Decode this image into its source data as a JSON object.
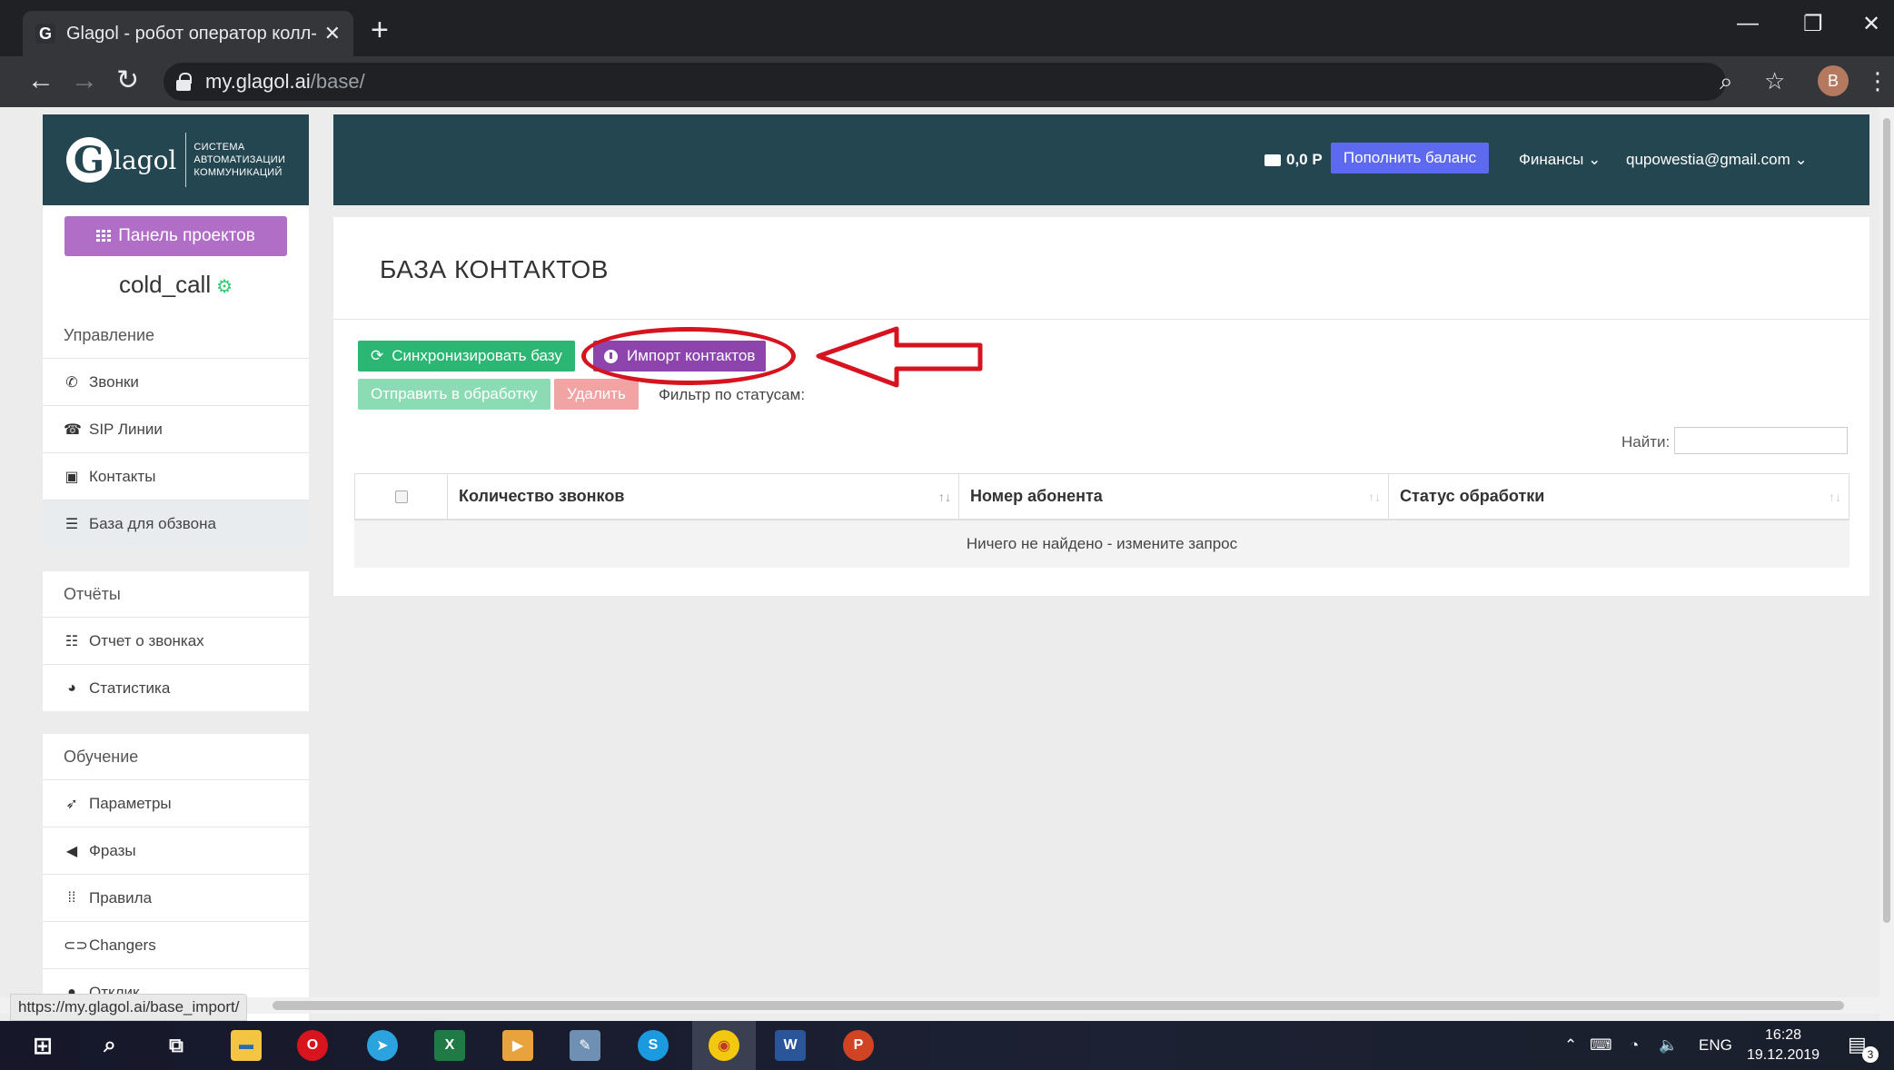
{
  "browser": {
    "tab_title": "Glagol - робот оператор колл-ц",
    "tab_close": "✕",
    "new_tab": "+",
    "url_host": "my.glagol.ai",
    "url_path": "/base/",
    "profile_initial": "B",
    "status_url": "https://my.glagol.ai/base_import/"
  },
  "logo": {
    "letter": "G",
    "name": "lagol",
    "sub_line1": "Система",
    "sub_line2": "автоматизации",
    "sub_line3": "коммуникаций"
  },
  "sidebar": {
    "projects_button": "Панель проектов",
    "project_name": "cold_call",
    "sections": [
      {
        "title": "Управление",
        "items": [
          {
            "label": "Звонки",
            "icon": "phone-icon"
          },
          {
            "label": "SIP Линии",
            "icon": "desk-phone-icon"
          },
          {
            "label": "Контакты",
            "icon": "contact-card-icon"
          },
          {
            "label": "База для обзвона",
            "icon": "database-icon",
            "active": true
          }
        ]
      },
      {
        "title": "Отчёты",
        "items": [
          {
            "label": "Отчет о звонках",
            "icon": "list-icon"
          },
          {
            "label": "Статистика",
            "icon": "pie-chart-icon"
          }
        ]
      },
      {
        "title": "Обучение",
        "items": [
          {
            "label": "Параметры",
            "icon": "rocket-icon"
          },
          {
            "label": "Фразы",
            "icon": "megaphone-icon"
          },
          {
            "label": "Правила",
            "icon": "rules-icon"
          },
          {
            "label": "Changers",
            "icon": "toggle-icon"
          },
          {
            "label": "Отклик",
            "icon": "pin-icon"
          }
        ]
      }
    ]
  },
  "topbar": {
    "balance": "0,0 Р",
    "topup_button": "Пополнить баланс",
    "finance_menu": "Финансы",
    "user_email": "qupowestia@gmail.com"
  },
  "main": {
    "page_title": "БАЗА КОНТАКТОВ",
    "sync_button": "Синхронизировать базу",
    "import_button": "Импорт контактов",
    "send_button": "Отправить в обработку",
    "delete_button": "Удалить",
    "filter_label": "Фильтр по статусам:",
    "search_label": "Найти:",
    "search_value": "",
    "table": {
      "columns": [
        "Количество звонков",
        "Номер абонента",
        "Статус обработки"
      ],
      "empty_message": "Ничего не найдено - измените запрос"
    }
  },
  "taskbar": {
    "apps": [
      "start-icon",
      "search-icon",
      "task-view-icon",
      "file-explorer-icon",
      "opera-icon",
      "telegram-icon",
      "excel-icon",
      "video-player-icon",
      "paint-icon",
      "skype-icon",
      "chrome-icon",
      "word-icon",
      "powerpoint-icon"
    ],
    "language": "ENG",
    "time": "16:28",
    "date": "19.12.2019",
    "notifications": "3"
  },
  "colors": {
    "header_dark": "#244650",
    "sync_green": "#2bb673",
    "import_purple": "#8e44ad",
    "projects_purple": "#b16ec7",
    "topup_blue": "#5d6af0",
    "annotation_red": "#d6141f"
  }
}
